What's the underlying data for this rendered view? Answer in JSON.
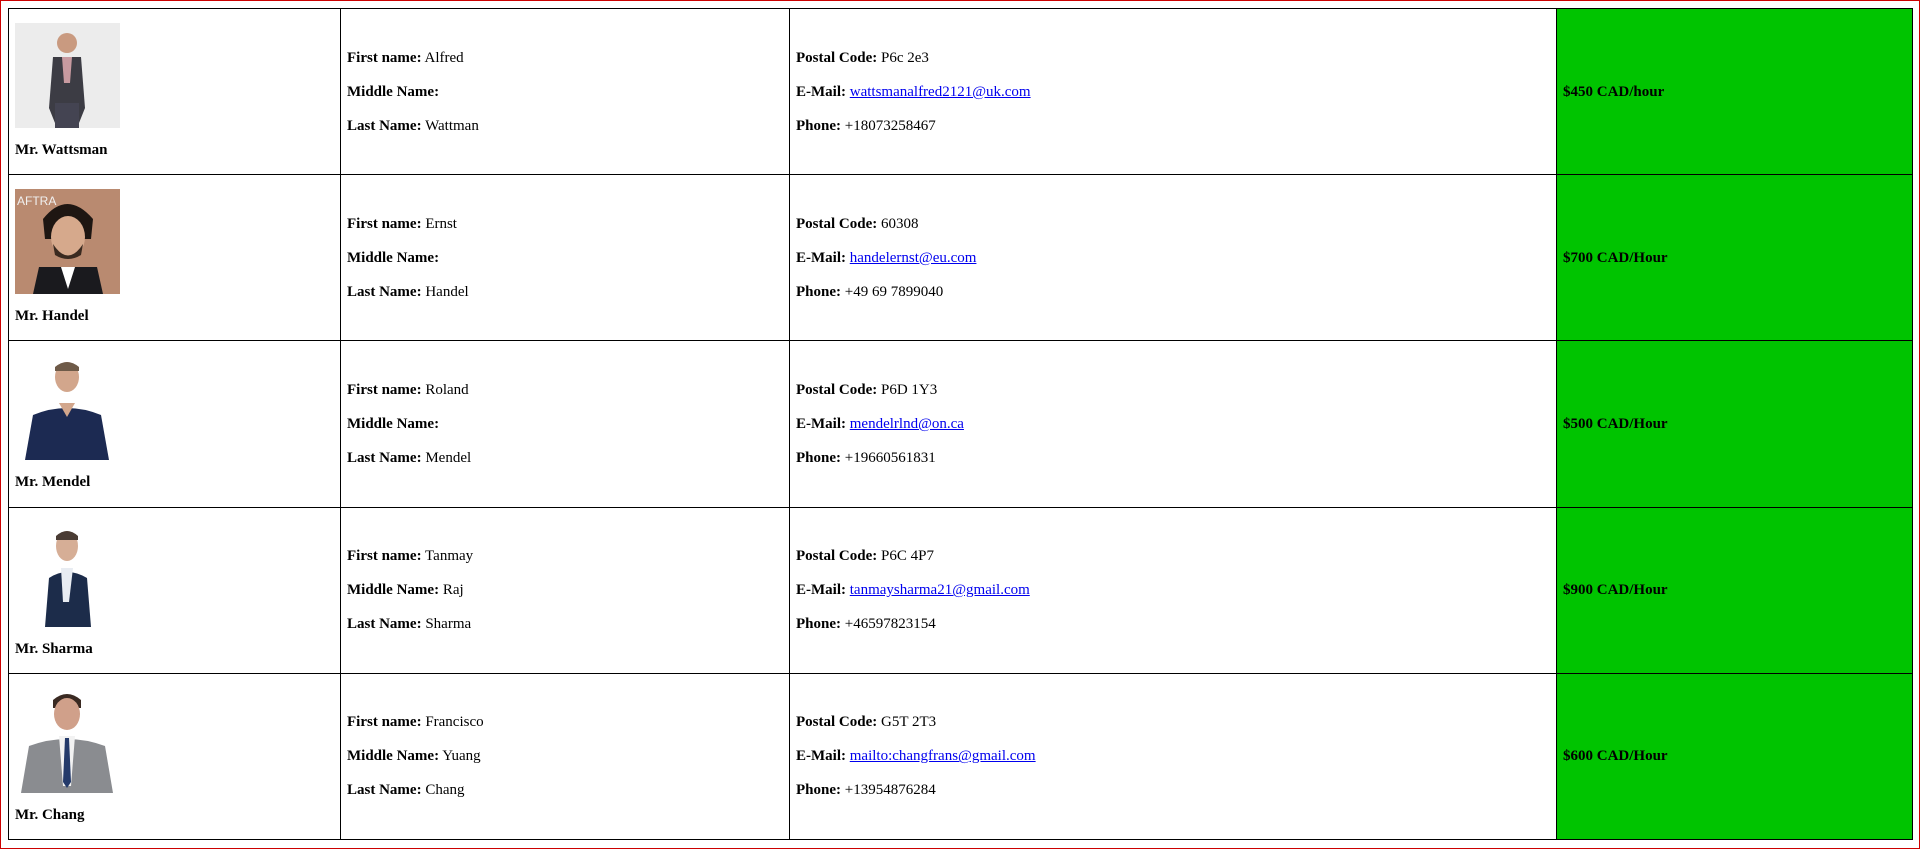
{
  "labels": {
    "first_name": "First name:",
    "middle_name": "Middle Name:",
    "last_name": "Last Name:",
    "postal_code": "Postal Code:",
    "email": "E-Mail:",
    "phone": "Phone:"
  },
  "colors": {
    "rate_bg": "#00c400",
    "link": "#0000ee",
    "frame": "#cc0000"
  },
  "people": [
    {
      "title": "Mr. Wattsman",
      "photo_icon": "person-photo",
      "first": "Alfred",
      "middle": "",
      "last": "Wattman",
      "postal": "P6c 2e3",
      "email": "wattsmanalfred2121@uk.com",
      "phone": "+18073258467",
      "rate": "$450 CAD/hour"
    },
    {
      "title": "Mr. Handel",
      "photo_icon": "person-photo",
      "first": "Ernst",
      "middle": "",
      "last": "Handel",
      "postal": "60308",
      "email": "handelernst@eu.com",
      "phone": "+49 69 7899040",
      "rate": "$700 CAD/Hour"
    },
    {
      "title": "Mr. Mendel",
      "photo_icon": "person-photo",
      "first": "Roland",
      "middle": "",
      "last": "Mendel",
      "postal": "P6D 1Y3",
      "email": "mendelrlnd@on.ca",
      "phone": "+19660561831",
      "rate": "$500 CAD/Hour"
    },
    {
      "title": "Mr. Sharma",
      "photo_icon": "person-photo",
      "first": "Tanmay",
      "middle": "Raj",
      "last": "Sharma",
      "postal": "P6C 4P7",
      "email": "tanmaysharma21@gmail.com",
      "phone": "+46597823154",
      "rate": "$900 CAD/Hour"
    },
    {
      "title": "Mr. Chang",
      "photo_icon": "person-photo",
      "first": "Francisco",
      "middle": "Yuang",
      "last": "Chang",
      "postal": "G5T 2T3",
      "email": "mailto:changfrans@gmail.com",
      "phone": "+13954876284",
      "rate": "$600 CAD/Hour"
    }
  ]
}
